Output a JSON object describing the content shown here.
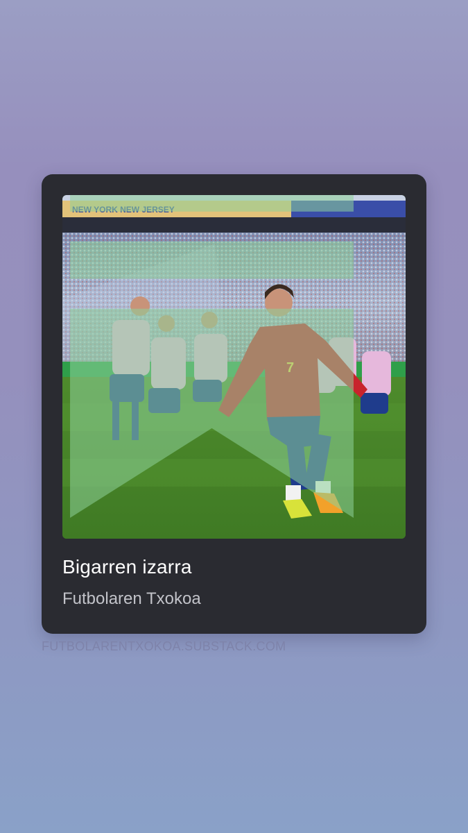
{
  "post": {
    "title": "Bigarren izarra",
    "publication": "Futbolaren Txokoa"
  },
  "image": {
    "banner_text": "NEW YORK NEW JERSEY",
    "player_number": "7"
  },
  "footer": {
    "domain": "FUTBOLARENTXOKOA.SUBSTACK.COM"
  },
  "icons": {
    "bookmark": "bookmark-icon"
  },
  "colors": {
    "card_bg": "#2a2b31",
    "title": "#ffffff",
    "subtitle": "#c2c3c9",
    "domain": "#7e83aa",
    "accent_green": "#8ed19a"
  }
}
